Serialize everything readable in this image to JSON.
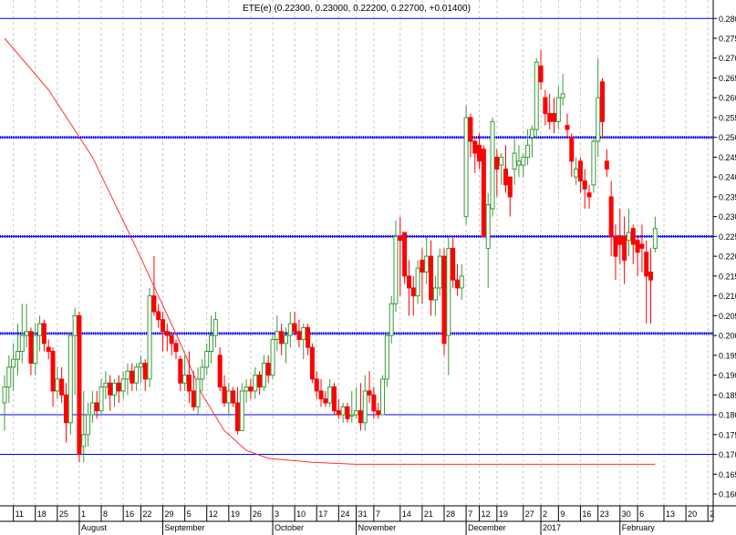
{
  "chart_data": {
    "type": "candlestick",
    "title": "ETE(e) (0.22300, 0.23000, 0.22200, 0.22700, +0.01400)",
    "ylim": [
      0.156,
      0.282
    ],
    "yticks": [
      "0.160",
      "0.165",
      "0.170",
      "0.175",
      "0.180",
      "0.185",
      "0.190",
      "0.195",
      "0.200",
      "0.205",
      "0.210",
      "0.215",
      "0.220",
      "0.225",
      "0.230",
      "0.235",
      "0.240",
      "0.245",
      "0.250",
      "0.255",
      "0.260",
      "0.265",
      "0.270",
      "0.275",
      "0.280"
    ],
    "xticks": [
      {
        "label": "11",
        "i": 2
      },
      {
        "label": "18",
        "i": 7
      },
      {
        "label": "25",
        "i": 12
      },
      {
        "label": "1",
        "i": 17
      },
      {
        "label": "8",
        "i": 22
      },
      {
        "label": "16",
        "i": 27
      },
      {
        "label": "22",
        "i": 31
      },
      {
        "label": "29",
        "i": 36
      },
      {
        "label": "5",
        "i": 41
      },
      {
        "label": "12",
        "i": 46
      },
      {
        "label": "19",
        "i": 51
      },
      {
        "label": "26",
        "i": 56
      },
      {
        "label": "3",
        "i": 61
      },
      {
        "label": "10",
        "i": 66
      },
      {
        "label": "17",
        "i": 71
      },
      {
        "label": "24",
        "i": 76
      },
      {
        "label": "31",
        "i": 80
      },
      {
        "label": "7",
        "i": 84
      },
      {
        "label": "14",
        "i": 90
      },
      {
        "label": "21",
        "i": 95
      },
      {
        "label": "28",
        "i": 100
      },
      {
        "label": "7",
        "i": 105
      },
      {
        "label": "12",
        "i": 108
      },
      {
        "label": "19",
        "i": 112
      },
      {
        "label": "27",
        "i": 118
      },
      {
        "label": "2",
        "i": 122
      },
      {
        "label": "9",
        "i": 126
      },
      {
        "label": "16",
        "i": 131
      },
      {
        "label": "23",
        "i": 135
      },
      {
        "label": "30",
        "i": 140
      },
      {
        "label": "6",
        "i": 144
      },
      {
        "label": "13",
        "i": 150
      },
      {
        "label": "20",
        "i": 155
      },
      {
        "label": "2",
        "i": 160
      }
    ],
    "months": [
      {
        "label": "August",
        "i": 17
      },
      {
        "label": "September",
        "i": 36
      },
      {
        "label": "October",
        "i": 61
      },
      {
        "label": "November",
        "i": 80
      },
      {
        "label": "December",
        "i": 105
      },
      {
        "label": "2017",
        "i": 122
      },
      {
        "label": "February",
        "i": 140
      }
    ],
    "hlines": [
      {
        "value": 0.28,
        "style": "solid"
      },
      {
        "value": 0.25,
        "style": "dotted"
      },
      {
        "value": 0.225,
        "style": "dotted"
      },
      {
        "value": 0.2005,
        "style": "dotted"
      },
      {
        "value": 0.18,
        "style": "solid"
      },
      {
        "value": 0.17,
        "style": "solid"
      }
    ],
    "moving_average": [
      [
        0,
        0.275
      ],
      [
        10,
        0.262
      ],
      [
        20,
        0.245
      ],
      [
        30,
        0.222
      ],
      [
        40,
        0.198
      ],
      [
        45,
        0.185
      ],
      [
        50,
        0.176
      ],
      [
        55,
        0.171
      ],
      [
        60,
        0.169
      ],
      [
        70,
        0.168
      ],
      [
        80,
        0.1675
      ],
      [
        148,
        0.1675
      ]
    ],
    "colors": {
      "up": "#3a9a3a",
      "down": "#ff0000",
      "hline": "#0000ff",
      "ma": "#ff3030",
      "grid": "#c8c8c8"
    },
    "ohlc": [
      [
        0.183,
        0.19,
        0.176,
        0.187
      ],
      [
        0.187,
        0.195,
        0.183,
        0.192
      ],
      [
        0.192,
        0.198,
        0.186,
        0.194
      ],
      [
        0.194,
        0.203,
        0.19,
        0.196
      ],
      [
        0.196,
        0.208,
        0.193,
        0.2
      ],
      [
        0.2,
        0.208,
        0.197,
        0.201
      ],
      [
        0.201,
        0.202,
        0.19,
        0.193
      ],
      [
        0.193,
        0.203,
        0.19,
        0.2
      ],
      [
        0.2,
        0.205,
        0.196,
        0.203
      ],
      [
        0.203,
        0.204,
        0.196,
        0.198
      ],
      [
        0.197,
        0.199,
        0.194,
        0.196
      ],
      [
        0.196,
        0.197,
        0.182,
        0.186
      ],
      [
        0.186,
        0.192,
        0.184,
        0.189
      ],
      [
        0.189,
        0.192,
        0.183,
        0.185
      ],
      [
        0.185,
        0.188,
        0.173,
        0.178
      ],
      [
        0.178,
        0.2,
        0.175,
        0.2
      ],
      [
        0.2,
        0.207,
        0.185,
        0.205
      ],
      [
        0.205,
        0.206,
        0.168,
        0.17
      ],
      [
        0.172,
        0.186,
        0.168,
        0.175
      ],
      [
        0.175,
        0.183,
        0.172,
        0.18
      ],
      [
        0.18,
        0.186,
        0.178,
        0.183
      ],
      [
        0.183,
        0.186,
        0.179,
        0.181
      ],
      [
        0.181,
        0.189,
        0.18,
        0.187
      ],
      [
        0.187,
        0.191,
        0.184,
        0.188
      ],
      [
        0.188,
        0.19,
        0.181,
        0.185
      ],
      [
        0.185,
        0.189,
        0.182,
        0.188
      ],
      [
        0.188,
        0.19,
        0.183,
        0.186
      ],
      [
        0.186,
        0.191,
        0.184,
        0.189
      ],
      [
        0.189,
        0.193,
        0.185,
        0.191
      ],
      [
        0.191,
        0.193,
        0.186,
        0.188
      ],
      [
        0.188,
        0.193,
        0.186,
        0.192
      ],
      [
        0.192,
        0.195,
        0.188,
        0.193
      ],
      [
        0.193,
        0.194,
        0.186,
        0.189
      ],
      [
        0.189,
        0.212,
        0.187,
        0.21
      ],
      [
        0.21,
        0.22,
        0.205,
        0.206
      ],
      [
        0.206,
        0.208,
        0.202,
        0.204
      ],
      [
        0.204,
        0.206,
        0.196,
        0.201
      ],
      [
        0.201,
        0.203,
        0.196,
        0.2
      ],
      [
        0.2,
        0.201,
        0.195,
        0.198
      ],
      [
        0.198,
        0.199,
        0.194,
        0.196
      ],
      [
        0.194,
        0.195,
        0.186,
        0.188
      ],
      [
        0.188,
        0.195,
        0.186,
        0.19
      ],
      [
        0.19,
        0.196,
        0.183,
        0.186
      ],
      [
        0.186,
        0.191,
        0.181,
        0.182
      ],
      [
        0.182,
        0.192,
        0.18,
        0.189
      ],
      [
        0.189,
        0.194,
        0.186,
        0.192
      ],
      [
        0.192,
        0.198,
        0.19,
        0.196
      ],
      [
        0.196,
        0.205,
        0.193,
        0.2
      ],
      [
        0.2,
        0.206,
        0.197,
        0.204
      ],
      [
        0.195,
        0.197,
        0.186,
        0.187
      ],
      [
        0.187,
        0.19,
        0.182,
        0.183
      ],
      [
        0.183,
        0.188,
        0.18,
        0.186
      ],
      [
        0.186,
        0.187,
        0.182,
        0.183
      ],
      [
        0.183,
        0.187,
        0.175,
        0.176
      ],
      [
        0.176,
        0.188,
        0.176,
        0.186
      ],
      [
        0.186,
        0.189,
        0.183,
        0.187
      ],
      [
        0.187,
        0.189,
        0.184,
        0.186
      ],
      [
        0.186,
        0.192,
        0.184,
        0.19
      ],
      [
        0.19,
        0.191,
        0.185,
        0.187
      ],
      [
        0.187,
        0.195,
        0.186,
        0.193
      ],
      [
        0.193,
        0.195,
        0.188,
        0.19
      ],
      [
        0.19,
        0.2,
        0.189,
        0.199
      ],
      [
        0.199,
        0.205,
        0.196,
        0.201
      ],
      [
        0.201,
        0.203,
        0.195,
        0.198
      ],
      [
        0.198,
        0.202,
        0.193,
        0.2
      ],
      [
        0.2,
        0.206,
        0.197,
        0.203
      ],
      [
        0.203,
        0.206,
        0.2,
        0.201
      ],
      [
        0.201,
        0.204,
        0.197,
        0.199
      ],
      [
        0.199,
        0.203,
        0.194,
        0.202
      ],
      [
        0.202,
        0.203,
        0.195,
        0.197
      ],
      [
        0.197,
        0.198,
        0.188,
        0.189
      ],
      [
        0.189,
        0.191,
        0.184,
        0.186
      ],
      [
        0.186,
        0.189,
        0.182,
        0.184
      ],
      [
        0.184,
        0.186,
        0.182,
        0.183
      ],
      [
        0.183,
        0.189,
        0.182,
        0.187
      ],
      [
        0.187,
        0.188,
        0.18,
        0.181
      ],
      [
        0.181,
        0.184,
        0.179,
        0.18
      ],
      [
        0.18,
        0.183,
        0.178,
        0.182
      ],
      [
        0.182,
        0.183,
        0.178,
        0.179
      ],
      [
        0.18,
        0.186,
        0.178,
        0.18
      ],
      [
        0.18,
        0.187,
        0.179,
        0.181
      ],
      [
        0.181,
        0.188,
        0.176,
        0.178
      ],
      [
        0.178,
        0.19,
        0.176,
        0.186
      ],
      [
        0.186,
        0.191,
        0.183,
        0.185
      ],
      [
        0.185,
        0.187,
        0.179,
        0.181
      ],
      [
        0.181,
        0.183,
        0.179,
        0.18
      ],
      [
        0.18,
        0.19,
        0.18,
        0.189
      ],
      [
        0.189,
        0.201,
        0.187,
        0.2
      ],
      [
        0.2,
        0.21,
        0.198,
        0.208
      ],
      [
        0.208,
        0.229,
        0.206,
        0.225
      ],
      [
        0.225,
        0.23,
        0.21,
        0.224
      ],
      [
        0.226,
        0.226,
        0.213,
        0.215
      ],
      [
        0.215,
        0.219,
        0.205,
        0.212
      ],
      [
        0.212,
        0.215,
        0.205,
        0.21
      ],
      [
        0.21,
        0.219,
        0.208,
        0.217
      ],
      [
        0.219,
        0.222,
        0.208,
        0.216
      ],
      [
        0.216,
        0.225,
        0.213,
        0.22
      ],
      [
        0.22,
        0.224,
        0.205,
        0.209
      ],
      [
        0.209,
        0.215,
        0.205,
        0.212
      ],
      [
        0.212,
        0.222,
        0.21,
        0.22
      ],
      [
        0.22,
        0.222,
        0.195,
        0.198
      ],
      [
        0.2,
        0.225,
        0.19,
        0.222
      ],
      [
        0.222,
        0.225,
        0.212,
        0.214
      ],
      [
        0.214,
        0.218,
        0.21,
        0.212
      ],
      [
        0.212,
        0.218,
        0.209,
        0.215
      ],
      [
        0.23,
        0.258,
        0.228,
        0.255
      ],
      [
        0.255,
        0.256,
        0.245,
        0.249
      ],
      [
        0.249,
        0.25,
        0.241,
        0.246
      ],
      [
        0.248,
        0.251,
        0.242,
        0.244
      ],
      [
        0.247,
        0.248,
        0.225,
        0.225
      ],
      [
        0.222,
        0.236,
        0.212,
        0.233
      ],
      [
        0.232,
        0.255,
        0.23,
        0.254
      ],
      [
        0.245,
        0.247,
        0.235,
        0.242
      ],
      [
        0.243,
        0.246,
        0.238,
        0.245
      ],
      [
        0.242,
        0.248,
        0.236,
        0.238
      ],
      [
        0.24,
        0.24,
        0.23,
        0.235
      ],
      [
        0.242,
        0.25,
        0.238,
        0.246
      ],
      [
        0.243,
        0.248,
        0.24,
        0.244
      ],
      [
        0.243,
        0.246,
        0.24,
        0.245
      ],
      [
        0.245,
        0.252,
        0.243,
        0.248
      ],
      [
        0.25,
        0.253,
        0.245,
        0.252
      ],
      [
        0.252,
        0.27,
        0.25,
        0.269
      ],
      [
        0.268,
        0.272,
        0.262,
        0.264
      ],
      [
        0.26,
        0.262,
        0.253,
        0.256
      ],
      [
        0.256,
        0.261,
        0.252,
        0.254
      ],
      [
        0.256,
        0.26,
        0.251,
        0.254
      ],
      [
        0.254,
        0.263,
        0.252,
        0.26
      ],
      [
        0.26,
        0.266,
        0.258,
        0.261
      ],
      [
        0.253,
        0.256,
        0.25,
        0.252
      ],
      [
        0.25,
        0.251,
        0.24,
        0.244
      ],
      [
        0.24,
        0.245,
        0.238,
        0.242
      ],
      [
        0.244,
        0.245,
        0.236,
        0.239
      ],
      [
        0.239,
        0.242,
        0.232,
        0.237
      ],
      [
        0.236,
        0.238,
        0.232,
        0.235
      ],
      [
        0.238,
        0.25,
        0.236,
        0.249
      ],
      [
        0.249,
        0.27,
        0.245,
        0.26
      ],
      [
        0.264,
        0.265,
        0.25,
        0.254
      ],
      [
        0.244,
        0.247,
        0.24,
        0.242
      ],
      [
        0.235,
        0.239,
        0.22,
        0.225
      ],
      [
        0.225,
        0.228,
        0.214,
        0.22
      ],
      [
        0.225,
        0.232,
        0.218,
        0.223
      ],
      [
        0.225,
        0.23,
        0.213,
        0.219
      ],
      [
        0.224,
        0.232,
        0.22,
        0.226
      ],
      [
        0.227,
        0.228,
        0.218,
        0.223
      ],
      [
        0.224,
        0.225,
        0.215,
        0.221
      ],
      [
        0.223,
        0.228,
        0.216,
        0.222
      ],
      [
        0.221,
        0.224,
        0.203,
        0.215
      ],
      [
        0.216,
        0.222,
        0.203,
        0.214
      ],
      [
        0.222,
        0.23,
        0.221,
        0.227
      ]
    ]
  }
}
